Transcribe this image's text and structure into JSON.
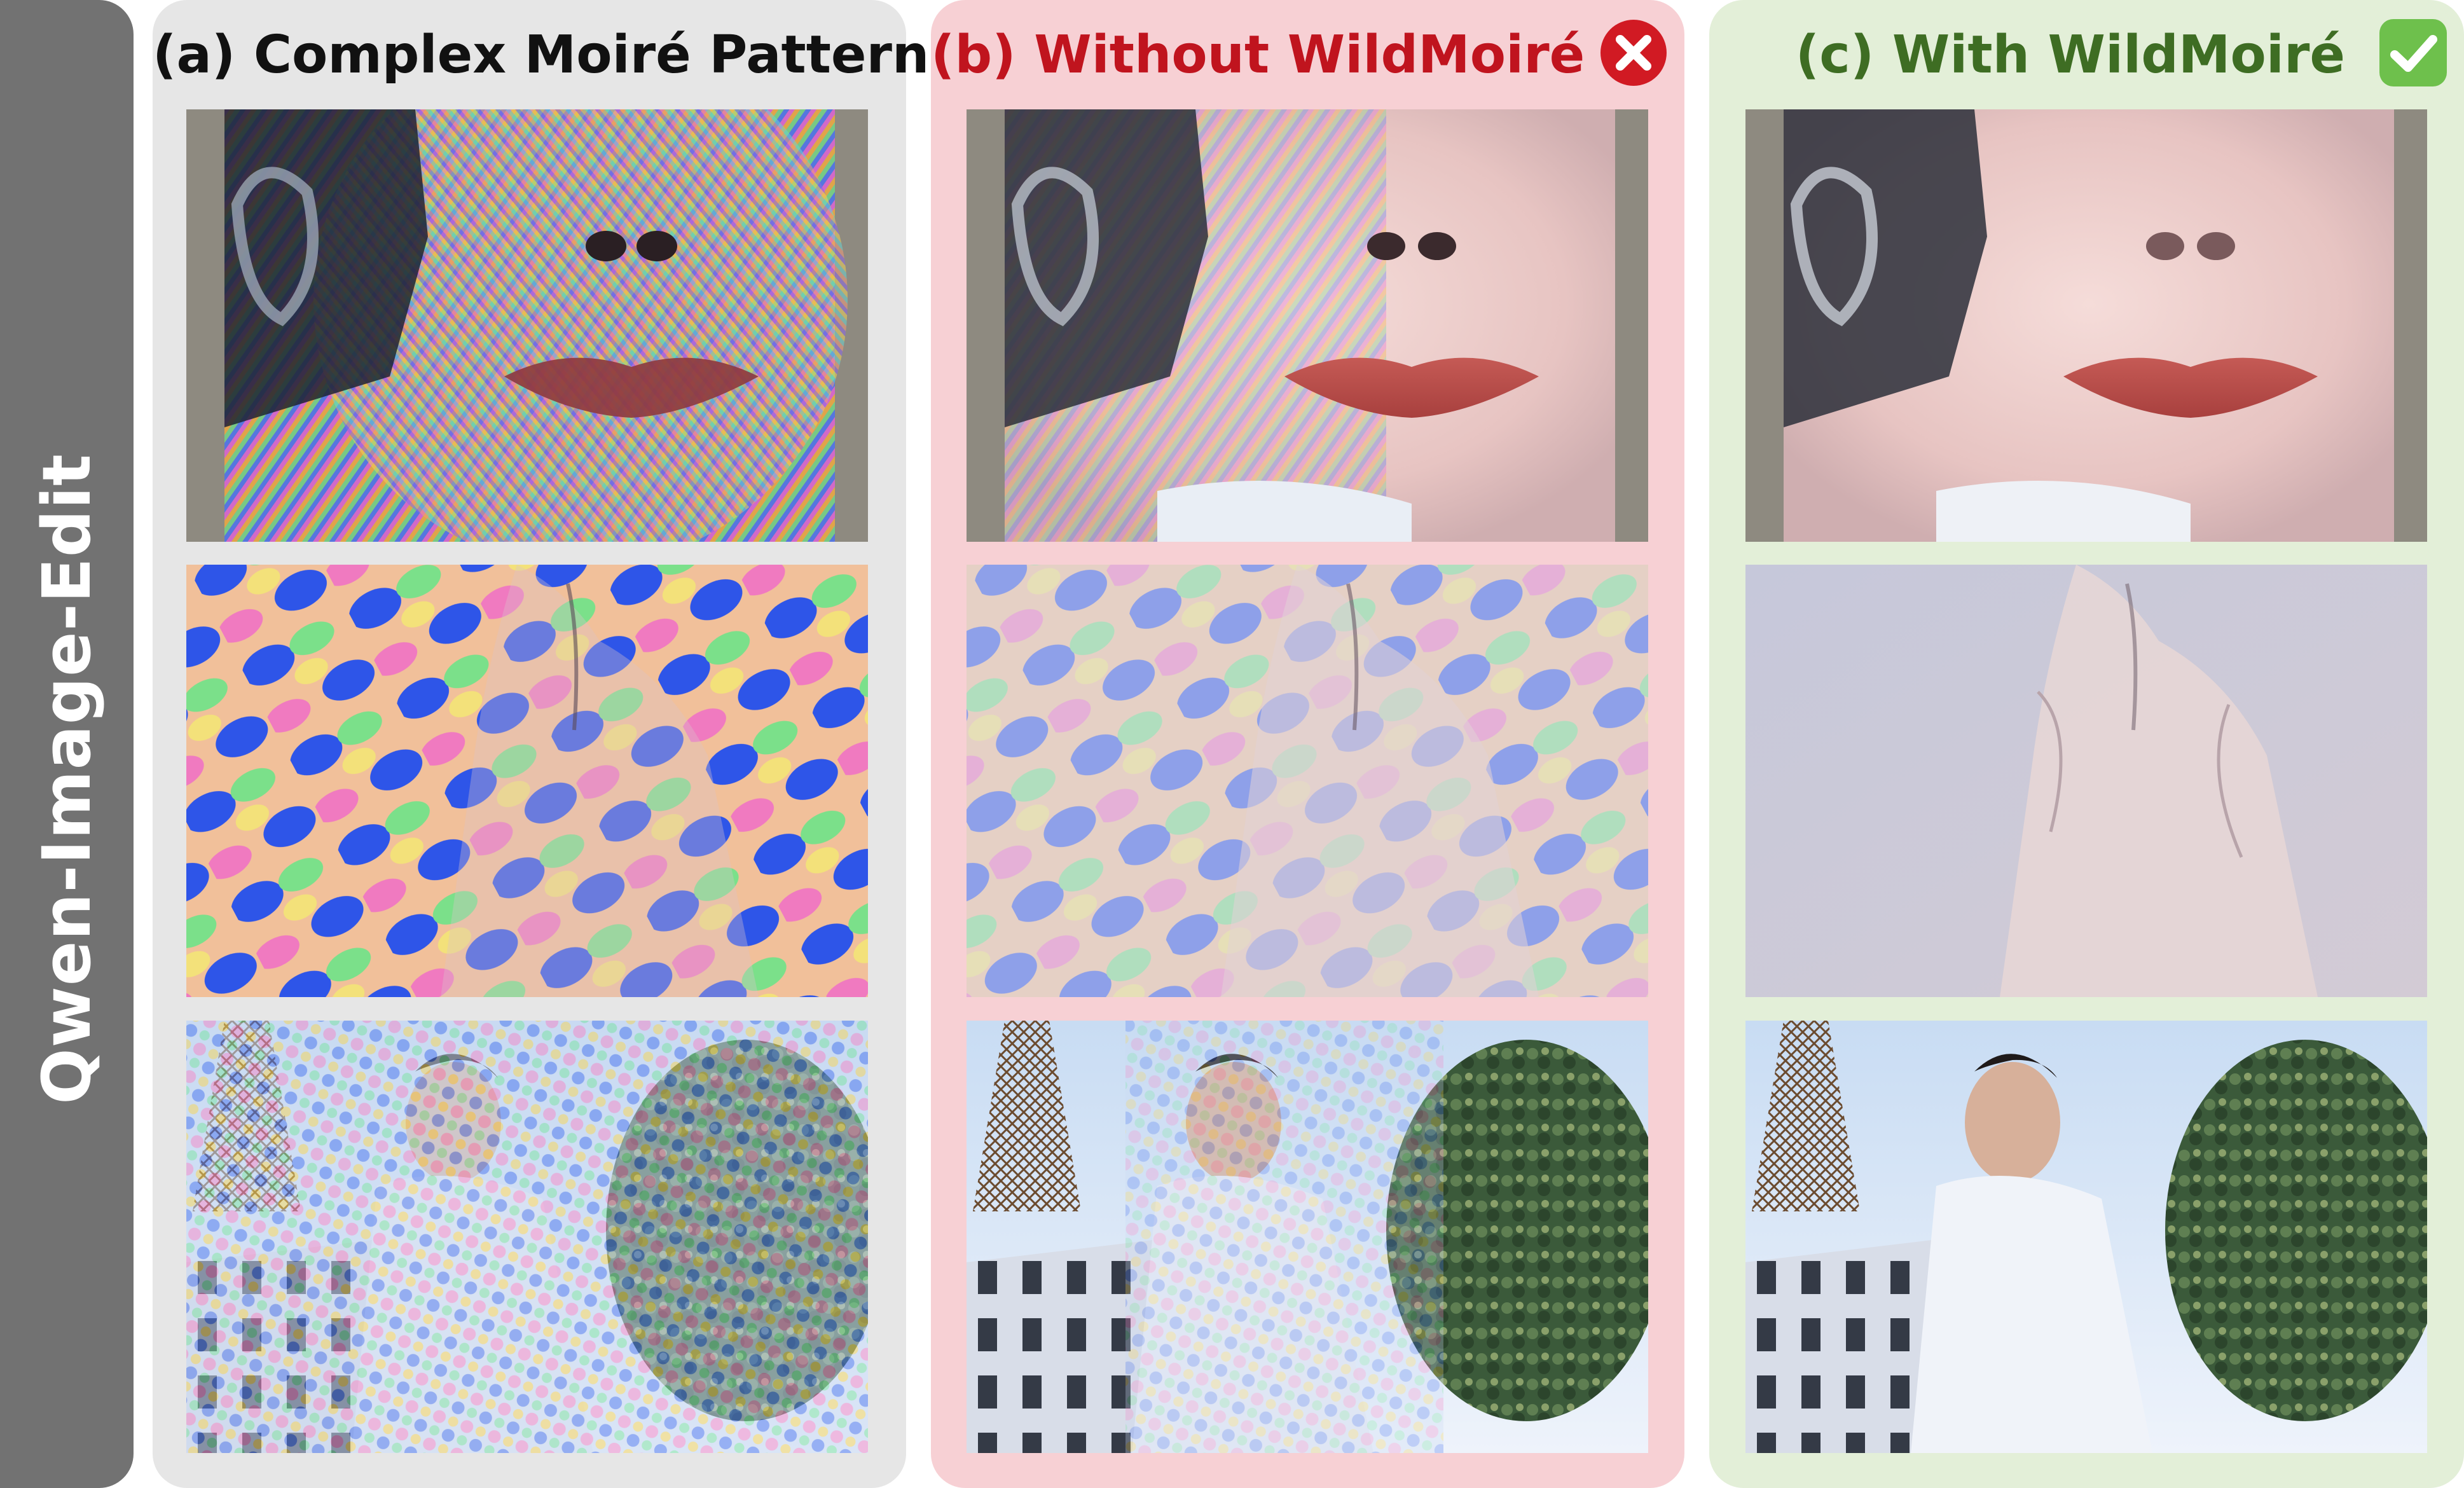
{
  "side_label": "Qwen-Image-Edit",
  "panels": {
    "a": {
      "title": "(a) Complex Moiré Patterns"
    },
    "b": {
      "title": "(b) Without WildMoiré",
      "badge": "cross-circle-icon",
      "badge_color": "#d11a23"
    },
    "c": {
      "title": "(c) With WildMoiré",
      "badge": "checkmark-icon",
      "badge_color": "#6ec04c"
    }
  },
  "colors": {
    "banner": "#727272",
    "panel_a_bg": "#e6e6e6",
    "panel_b_bg": "#f7d0d4",
    "panel_c_bg": "#e3efd8",
    "title_b": "#c0141e",
    "title_c": "#3e6d23"
  },
  "scenes": [
    "face-closeup",
    "jacket-torso",
    "man-with-eiffel-tower"
  ]
}
